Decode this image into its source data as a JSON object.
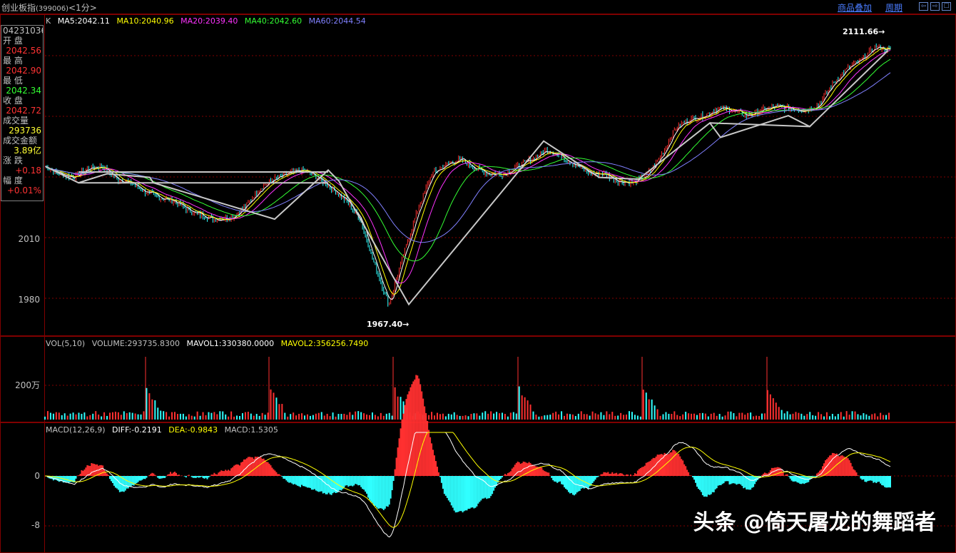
{
  "window": {
    "title": "创业板指",
    "code": "(399006)",
    "period": "<1分>",
    "menu_overlay": "商品叠加",
    "menu_period": "周期",
    "btn_prev": "⇦",
    "btn_next": "⇨",
    "btn_max": "☐"
  },
  "info_panel": {
    "time": "04231036",
    "rows": [
      {
        "label": "开  盘",
        "value": "2042.56",
        "color": "#ff3333"
      },
      {
        "label": "最  高",
        "value": "2042.90",
        "color": "#ff3333"
      },
      {
        "label": "最  低",
        "value": "2042.34",
        "color": "#33ff33"
      },
      {
        "label": "收  盘",
        "value": "2042.72",
        "color": "#ff3333"
      },
      {
        "label": "成交量",
        "value": "293736",
        "color": "#ffff33"
      },
      {
        "label": "成交金额",
        "value": "3.89亿",
        "color": "#ffff33"
      },
      {
        "label": "涨  跌",
        "value": "+0.18",
        "color": "#ff3333"
      },
      {
        "label": "幅  度",
        "value": "+0.01%",
        "color": "#ff3333"
      }
    ]
  },
  "kline_legend": [
    {
      "text": "K",
      "color": "#c0c0c0"
    },
    {
      "text": "MA5:2042.11",
      "color": "#ffffff"
    },
    {
      "text": "MA10:2040.96",
      "color": "#ffff00"
    },
    {
      "text": "MA20:2039.40",
      "color": "#ff33ff"
    },
    {
      "text": "MA40:2042.60",
      "color": "#33ff33"
    },
    {
      "text": "MA60:2044.54",
      "color": "#8080ff"
    }
  ],
  "price_axis": {
    "labels": [
      "2010",
      "1980"
    ]
  },
  "annotations": {
    "high": "2111.66",
    "low": "1967.40"
  },
  "vol_legend": [
    {
      "text": "VOL(5,10)",
      "color": "#c0c0c0"
    },
    {
      "text": "VOLUME:293735.8300",
      "color": "#c0c0c0"
    },
    {
      "text": "MAVOL1:330380.0000",
      "color": "#ffffff"
    },
    {
      "text": "MAVOL2:356256.7490",
      "color": "#ffff00"
    }
  ],
  "vol_axis": {
    "labels": [
      "200万"
    ]
  },
  "macd_legend": [
    {
      "text": "MACD(12,26,9)",
      "color": "#c0c0c0"
    },
    {
      "text": "DIFF:-0.2191",
      "color": "#ffffff"
    },
    {
      "text": "DEA:-0.9843",
      "color": "#ffff00"
    },
    {
      "text": "MACD:1.5305",
      "color": "#c0c0c0"
    }
  ],
  "macd_axis": {
    "labels": [
      "0",
      "-8"
    ]
  },
  "watermark": "头条 @倚天屠龙的舞蹈者",
  "chart_data": {
    "type": "line",
    "title": "",
    "ylim": [
      1960,
      2120
    ],
    "high": 2111.66,
    "low": 1967.4,
    "price_path": [
      2044,
      2040,
      2038,
      2043,
      2044,
      2037,
      2035,
      2030,
      2027,
      2025,
      2020,
      2017,
      2015,
      2016,
      2022,
      2032,
      2037,
      2040,
      2042,
      2038,
      2032,
      2025,
      2015,
      1990,
      1968,
      1995,
      2020,
      2040,
      2045,
      2048,
      2043,
      2040,
      2040,
      2044,
      2048,
      2053,
      2050,
      2045,
      2040,
      2040,
      2036,
      2035,
      2039,
      2050,
      2065,
      2070,
      2072,
      2076,
      2075,
      2072,
      2075,
      2077,
      2076,
      2075,
      2078,
      2090,
      2098,
      2103,
      2110,
      2108
    ]
  }
}
